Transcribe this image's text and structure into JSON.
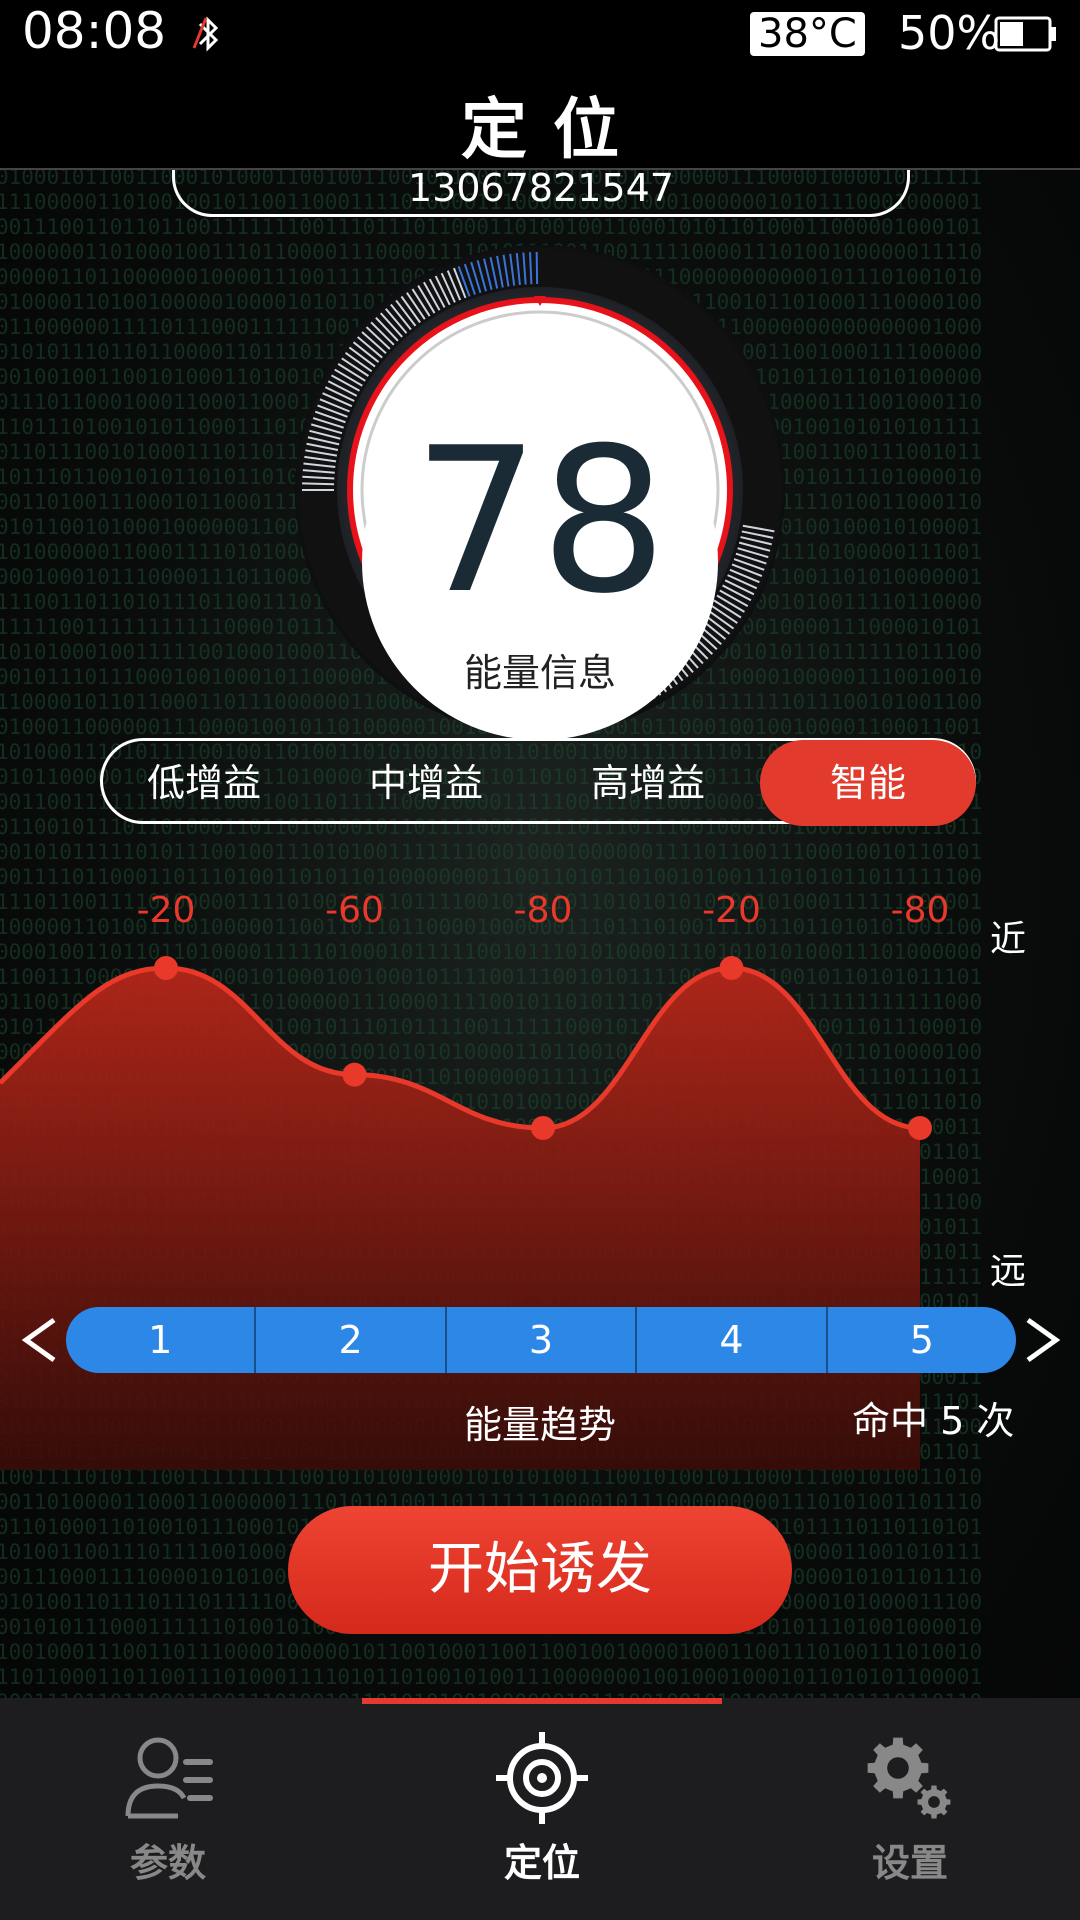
{
  "status_bar": {
    "time": "08:08",
    "temperature": "38°C",
    "battery_percent": "50%",
    "battery_level": 0.5,
    "bluetooth_icon": "bluetooth-off-icon"
  },
  "header": {
    "title": "定位"
  },
  "device": {
    "phone": "13067821547"
  },
  "gauge": {
    "value": "78",
    "label": "能量信息"
  },
  "gain_modes": {
    "options": [
      "低增益",
      "中增益",
      "高增益",
      "智能"
    ],
    "selected": "智能"
  },
  "chart_data": {
    "type": "area",
    "x": [
      1,
      2,
      3,
      4,
      5
    ],
    "values": [
      -20,
      -60,
      -80,
      -20,
      -80
    ],
    "data_labels": [
      "-20",
      "-60",
      "-80",
      "-20",
      "-80"
    ],
    "y_top_label": "近",
    "y_bottom_label": "远",
    "series_color": "#e23a2c"
  },
  "segments": [
    "1",
    "2",
    "3",
    "4",
    "5"
  ],
  "trend_label": "能量趋势",
  "hits_label": "命中 5 次",
  "action": {
    "start_label": "开始诱发"
  },
  "tabs": [
    {
      "label": "参数",
      "icon": "user-list-icon"
    },
    {
      "label": "定位",
      "icon": "target-icon"
    },
    {
      "label": "设置",
      "icon": "gears-icon"
    }
  ],
  "colors": {
    "accent": "#e23a2c",
    "segment_blue": "#2c87e6"
  }
}
